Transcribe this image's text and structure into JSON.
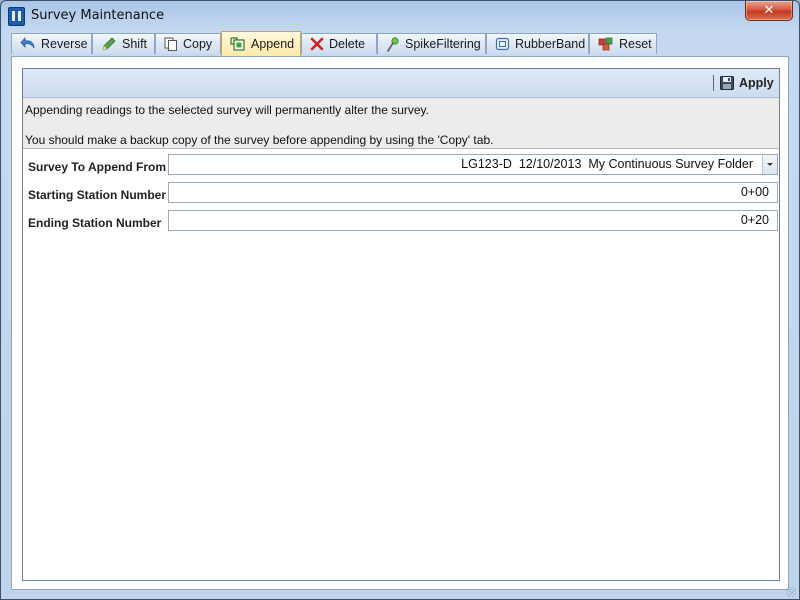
{
  "window": {
    "title": "Survey Maintenance",
    "close_label": "✕"
  },
  "tabs": [
    {
      "label": "Reverse",
      "icon": "reverse-arrow-icon"
    },
    {
      "label": "Shift",
      "icon": "shift-pencil-icon"
    },
    {
      "label": "Copy",
      "icon": "copy-icon"
    },
    {
      "label": "Append",
      "icon": "append-icon",
      "active": true
    },
    {
      "label": "Delete",
      "icon": "delete-x-icon"
    },
    {
      "label": "SpikeFiltering",
      "icon": "spike-filter-icon"
    },
    {
      "label": "RubberBand",
      "icon": "rubber-band-icon"
    },
    {
      "label": "Reset",
      "icon": "reset-icon"
    }
  ],
  "toolbar": {
    "apply_label": "Apply",
    "apply_icon": "save-disk-icon"
  },
  "message": {
    "line1": "Appending readings to the selected survey will permanently alter the survey.",
    "line2": "You should make a backup copy of the survey before appending by using the 'Copy' tab."
  },
  "form": {
    "survey_label": "Survey To Append From",
    "survey_value": "LG123-D  12/10/2013  My Continuous Survey Folder",
    "start_label": "Starting Station Number",
    "start_value": "0+00",
    "end_label": "Ending Station Number",
    "end_value": "0+20"
  },
  "colors": {
    "active_tab": "#ffe9a8",
    "toolbar": "#cddcef",
    "message_bg": "#ececec",
    "close_button": "#c43a1f"
  }
}
